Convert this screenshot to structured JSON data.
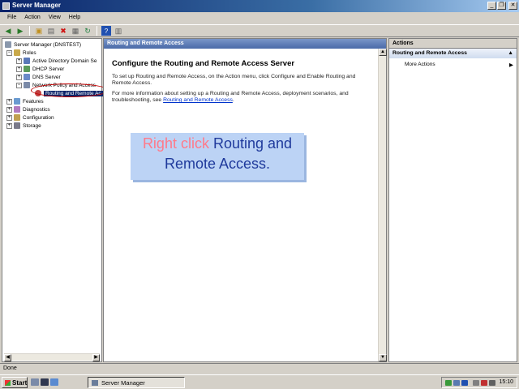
{
  "window": {
    "title": "Server Manager"
  },
  "menubar": [
    "File",
    "Action",
    "View",
    "Help"
  ],
  "toolbar_icons": [
    "back-icon",
    "forward-icon",
    "up-icon",
    "console-tree-icon",
    "delete-icon",
    "properties-icon",
    "refresh-icon",
    "help-icon",
    "show-hide-icon"
  ],
  "tree": {
    "root": "Server Manager (DNSTEST)",
    "roles": "Roles",
    "ad": "Active Directory Domain Se",
    "dhcp": "DHCP Server",
    "dns": "DNS Server",
    "npa": "Network Policy and Access",
    "rras": "Routing and Remote Ac",
    "features": "Features",
    "diagnostics": "Diagnostics",
    "configuration": "Configuration",
    "storage": "Storage"
  },
  "center": {
    "header": "Routing and Remote Access",
    "title": "Configure the Routing and Remote Access Server",
    "para1": "To set up Routing and Remote Access, on the Action menu, click Configure and Enable Routing and Remote Access.",
    "para2_prefix": "For more information about setting up a Routing and Remote Access, deployment scenarios, and troubleshooting, see",
    "para2_link": "Routing and Remote Access",
    "para2_suffix": "."
  },
  "callout": {
    "action": "Right click",
    "target": "Routing and Remote Access."
  },
  "actions": {
    "header": "Actions",
    "group": "Routing and Remote Access",
    "items": [
      "More Actions"
    ]
  },
  "status": "Done",
  "taskbar": {
    "start": "Start",
    "task": "Server Manager",
    "clock": "15:10"
  },
  "colors": {
    "selection": "#0a246a",
    "annotation_circle": "#c00000",
    "callout_bg": "#bcd3f5"
  }
}
